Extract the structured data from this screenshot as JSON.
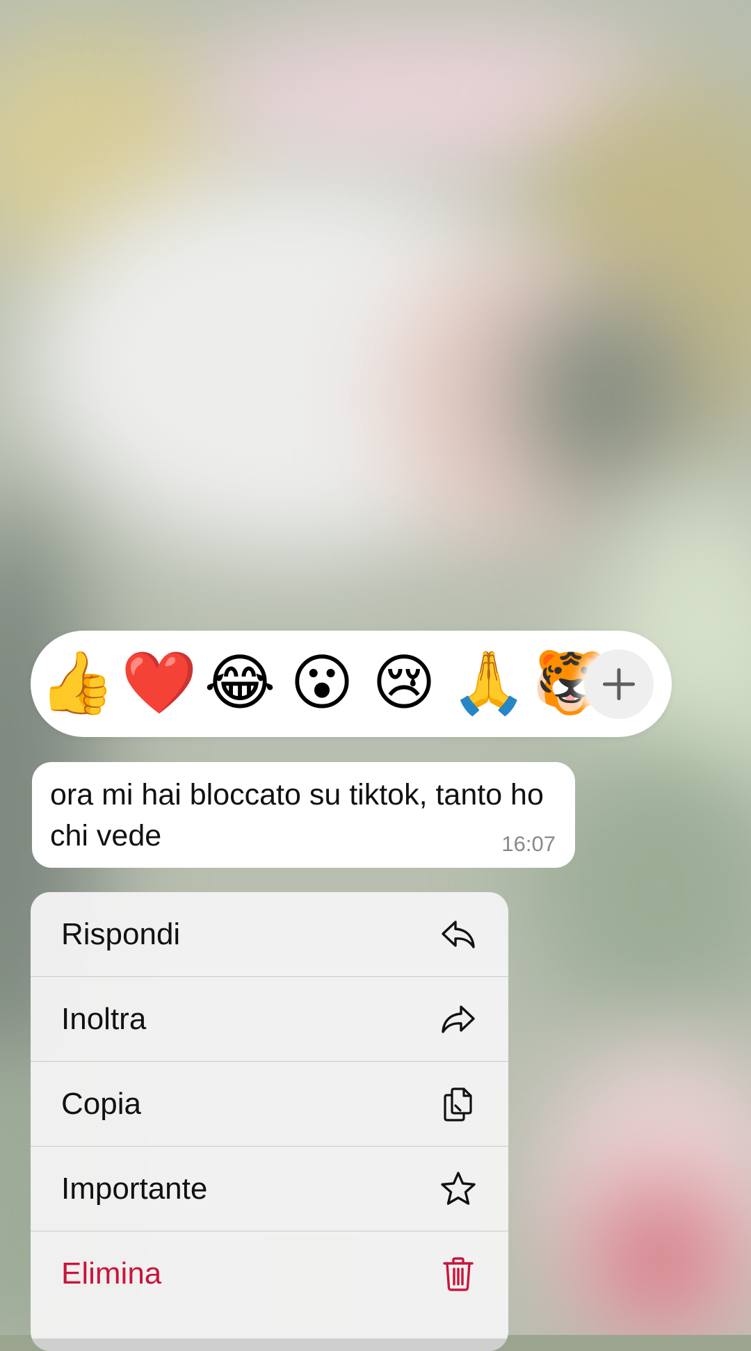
{
  "reactions": {
    "emojis": [
      {
        "name": "thumbs-up",
        "char": "👍"
      },
      {
        "name": "red-heart",
        "char": "❤️"
      },
      {
        "name": "face-with-tears-of-joy",
        "char": "😂"
      },
      {
        "name": "astonished-face",
        "char": "😮"
      },
      {
        "name": "crying-face",
        "char": "😢"
      },
      {
        "name": "folded-hands",
        "char": "🙏"
      },
      {
        "name": "tiger-face",
        "char": "🐯"
      }
    ],
    "more_icon": "plus-icon"
  },
  "message": {
    "text": "ora mi hai bloccato su tiktok, tanto ho chi vede",
    "time": "16:07"
  },
  "menu": {
    "items": [
      {
        "label": "Rispondi",
        "icon": "reply-icon"
      },
      {
        "label": "Inoltra",
        "icon": "forward-icon"
      },
      {
        "label": "Copia",
        "icon": "copy-icon"
      },
      {
        "label": "Importante",
        "icon": "star-icon"
      },
      {
        "label": "Elimina",
        "icon": "trash-icon"
      }
    ],
    "danger_color": "#c8153c"
  }
}
